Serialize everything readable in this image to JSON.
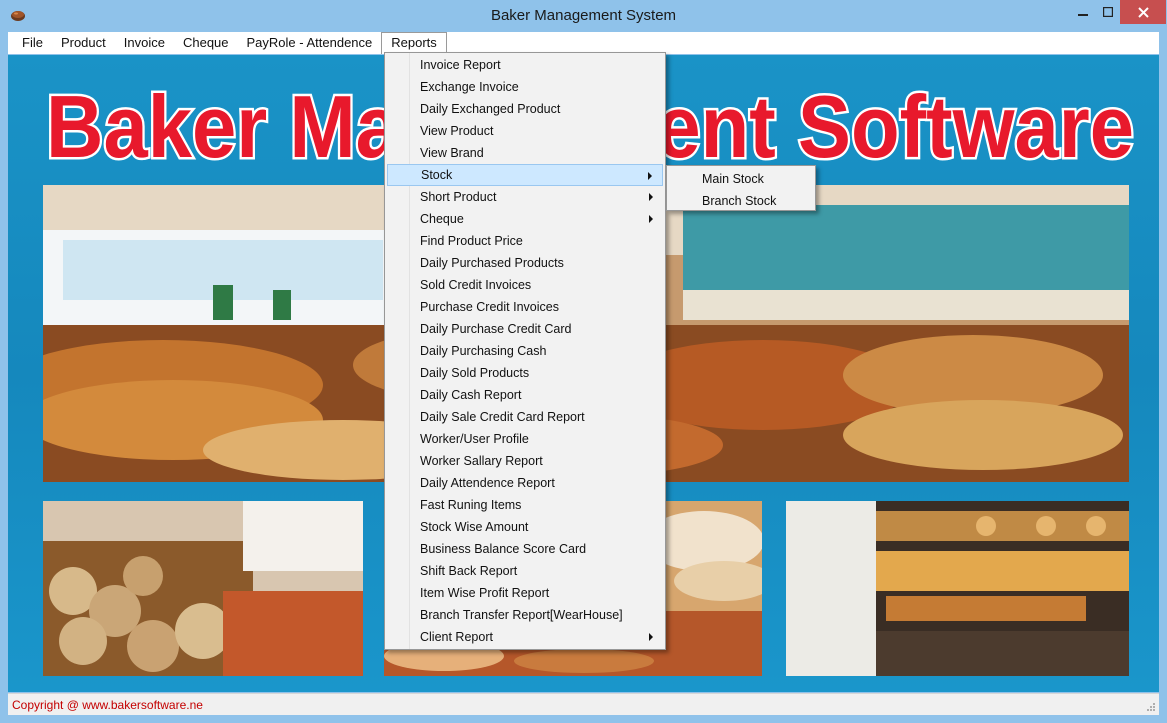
{
  "window": {
    "title": "Baker Management System"
  },
  "menubar": {
    "items": [
      "File",
      "Product",
      "Invoice",
      "Cheque",
      "PayRole  - Attendence",
      "Reports"
    ],
    "active_index": 5
  },
  "banner": {
    "text": "Baker Management Software"
  },
  "reports_menu": {
    "items": [
      {
        "label": "Invoice Report",
        "submenu": false
      },
      {
        "label": "Exchange Invoice",
        "submenu": false
      },
      {
        "label": "Daily Exchanged Product",
        "submenu": false
      },
      {
        "label": "View Product",
        "submenu": false
      },
      {
        "label": "View Brand",
        "submenu": false
      },
      {
        "label": "Stock",
        "submenu": true
      },
      {
        "label": "Short Product",
        "submenu": true
      },
      {
        "label": "Cheque",
        "submenu": true
      },
      {
        "label": "Find Product Price",
        "submenu": false
      },
      {
        "label": "Daily Purchased Products",
        "submenu": false
      },
      {
        "label": "Sold Credit Invoices",
        "submenu": false
      },
      {
        "label": "Purchase Credit Invoices",
        "submenu": false
      },
      {
        "label": "Daily Purchase Credit Card",
        "submenu": false
      },
      {
        "label": "Daily Purchasing Cash",
        "submenu": false
      },
      {
        "label": "Daily Sold Products",
        "submenu": false
      },
      {
        "label": "Daily Cash Report",
        "submenu": false
      },
      {
        "label": "Daily Sale Credit Card Report",
        "submenu": false
      },
      {
        "label": "Worker/User Profile",
        "submenu": false
      },
      {
        "label": "Worker Sallary Report",
        "submenu": false
      },
      {
        "label": "Daily Attendence Report",
        "submenu": false
      },
      {
        "label": "Fast Runing Items",
        "submenu": false
      },
      {
        "label": "Stock Wise Amount",
        "submenu": false
      },
      {
        "label": "Business Balance Score Card",
        "submenu": false
      },
      {
        "label": "Shift Back Report",
        "submenu": false
      },
      {
        "label": "Item Wise Profit Report",
        "submenu": false
      },
      {
        "label": "Branch Transfer Report[WearHouse]",
        "submenu": false
      },
      {
        "label": "Client Report",
        "submenu": true
      }
    ],
    "hover_index": 5
  },
  "stock_submenu": {
    "items": [
      "Main Stock",
      "Branch Stock"
    ]
  },
  "statusbar": {
    "text": "Copyright @ www.bakersoftware.ne"
  },
  "colors": {
    "titlebar": "#8fc2ea",
    "close_button": "#c74f4f",
    "banner_text": "#e8192c",
    "menu_hover": "#cde8ff",
    "status_text": "#c40000",
    "background": "#1a93c7"
  }
}
